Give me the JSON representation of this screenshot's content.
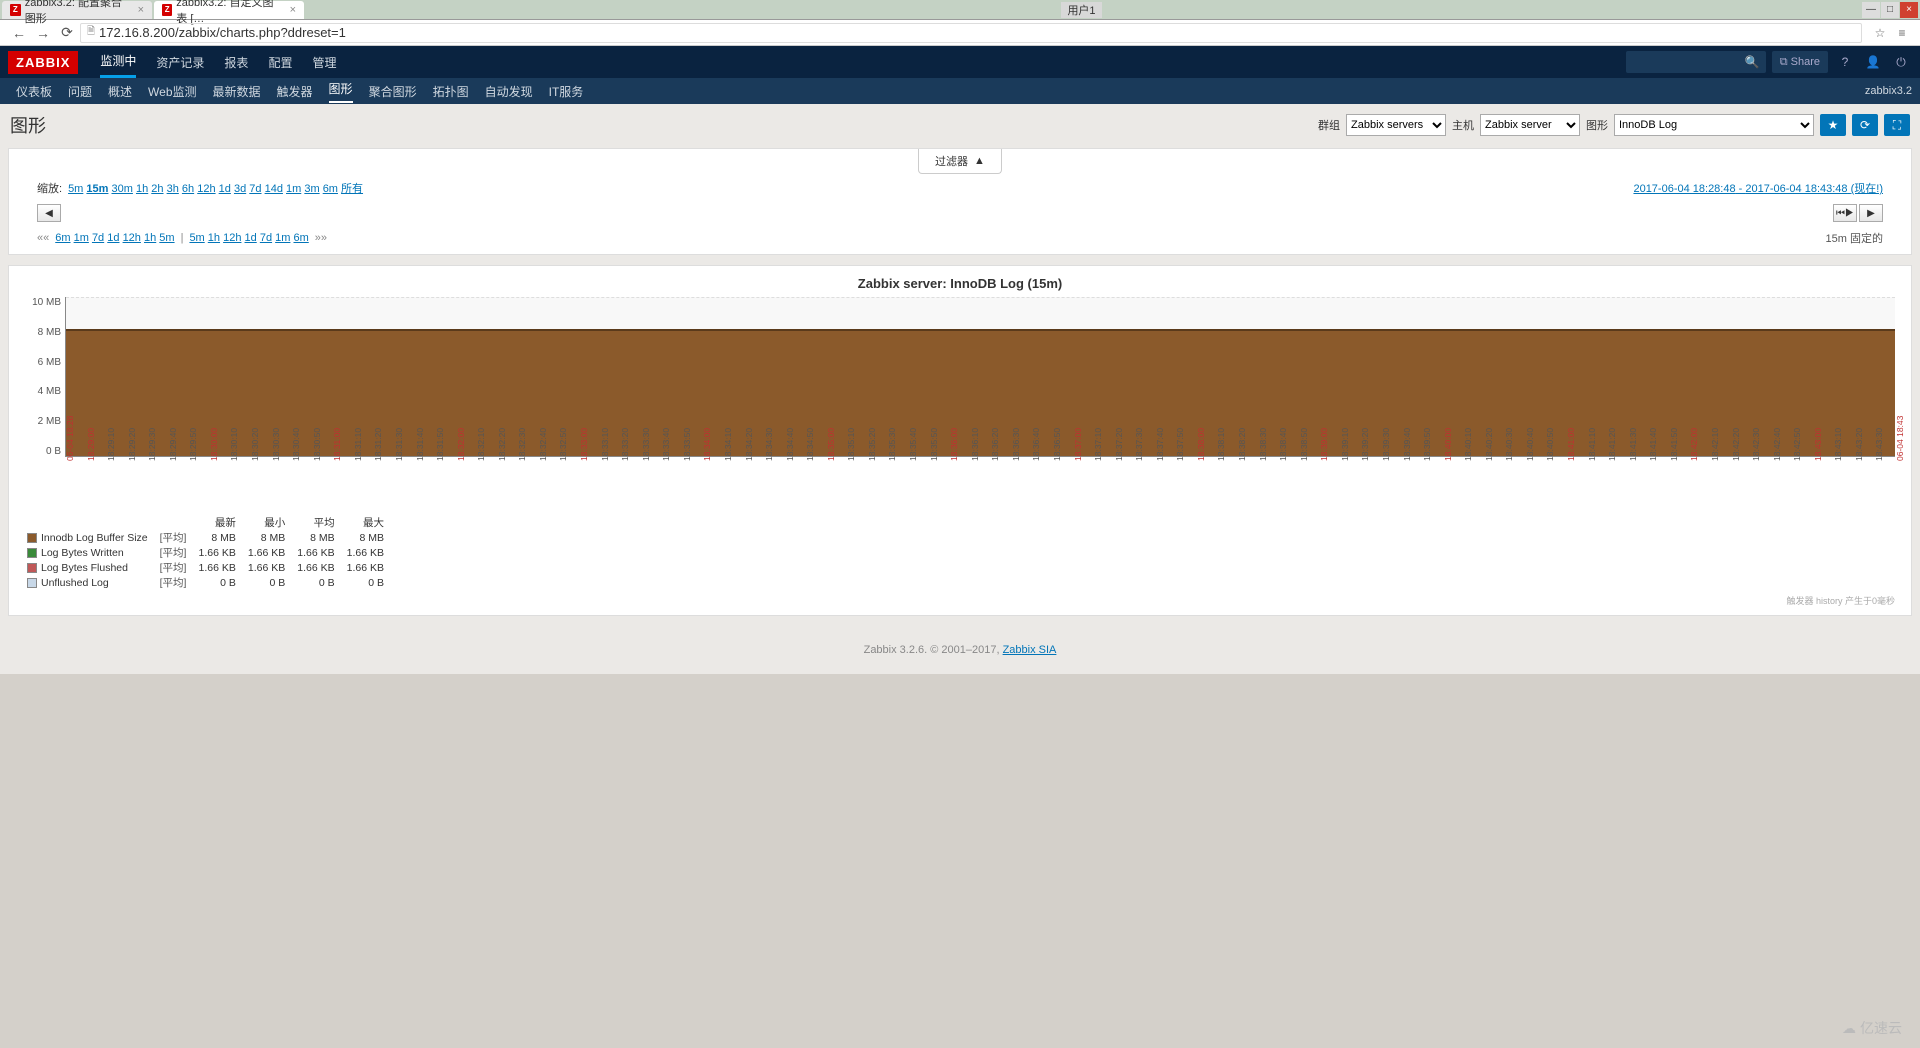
{
  "browser": {
    "tabs": [
      {
        "title": "zabbix3.2: 配置聚合图形"
      },
      {
        "title": "zabbix3.2: 自定义图表 […"
      }
    ],
    "user_badge": "用户1",
    "url": "172.16.8.200/zabbix/charts.php?ddreset=1"
  },
  "top_nav": {
    "logo": "ZABBIX",
    "items": [
      "监测中",
      "资产记录",
      "报表",
      "配置",
      "管理"
    ],
    "active_index": 0,
    "share": "Share"
  },
  "sub_nav": {
    "items": [
      "仪表板",
      "问题",
      "概述",
      "Web监测",
      "最新数据",
      "触发器",
      "图形",
      "聚合图形",
      "拓扑图",
      "自动发现",
      "IT服务"
    ],
    "active_index": 6,
    "right": "zabbix3.2"
  },
  "page_head": {
    "title": "图形",
    "group_label": "群组",
    "group_value": "Zabbix servers",
    "host_label": "主机",
    "host_value": "Zabbix server",
    "graph_label": "图形",
    "graph_value": "InnoDB Log"
  },
  "filter": {
    "tab": "过滤器",
    "zoom_label": "缩放:",
    "zoom_opts": [
      "5m",
      "15m",
      "30m",
      "1h",
      "2h",
      "3h",
      "6h",
      "12h",
      "1d",
      "3d",
      "7d",
      "14d",
      "1m",
      "3m",
      "6m",
      "所有"
    ],
    "zoom_active": "15m",
    "time_from": "2017-06-04 18:28:48",
    "time_to": "2017-06-04 18:43:48",
    "now_suffix": "(现在!)",
    "shift_left": [
      "6m",
      "1m",
      "7d",
      "1d",
      "12h",
      "1h",
      "5m"
    ],
    "shift_right": [
      "5m",
      "1h",
      "12h",
      "1d",
      "7d",
      "1m",
      "6m"
    ],
    "fixed_label": "固定的",
    "fixed_value": "15m"
  },
  "chart_data": {
    "type": "area",
    "title": "Zabbix server: InnoDB Log (15m)",
    "ylabel": "",
    "ylim": [
      0,
      10485760
    ],
    "y_ticks": [
      "10 MB",
      "8 MB",
      "6 MB",
      "4 MB",
      "2 MB",
      "0 B"
    ],
    "x_range": [
      "06-04 18:28",
      "06-04 18:43"
    ],
    "x_ticks": [
      {
        "t": "06-04 18:28",
        "red": true
      },
      {
        "t": "18:29:00",
        "red": true
      },
      {
        "t": "18:29:10"
      },
      {
        "t": "18:29:20"
      },
      {
        "t": "18:29:30"
      },
      {
        "t": "18:29:40"
      },
      {
        "t": "18:29:50"
      },
      {
        "t": "18:30:00",
        "red": true
      },
      {
        "t": "18:30:10"
      },
      {
        "t": "18:30:20"
      },
      {
        "t": "18:30:30"
      },
      {
        "t": "18:30:40"
      },
      {
        "t": "18:30:50"
      },
      {
        "t": "18:31:00",
        "red": true
      },
      {
        "t": "18:31:10"
      },
      {
        "t": "18:31:20"
      },
      {
        "t": "18:31:30"
      },
      {
        "t": "18:31:40"
      },
      {
        "t": "18:31:50"
      },
      {
        "t": "18:32:00",
        "red": true
      },
      {
        "t": "18:32:10"
      },
      {
        "t": "18:32:20"
      },
      {
        "t": "18:32:30"
      },
      {
        "t": "18:32:40"
      },
      {
        "t": "18:32:50"
      },
      {
        "t": "18:33:00",
        "red": true
      },
      {
        "t": "18:33:10"
      },
      {
        "t": "18:33:20"
      },
      {
        "t": "18:33:30"
      },
      {
        "t": "18:33:40"
      },
      {
        "t": "18:33:50"
      },
      {
        "t": "18:34:00",
        "red": true
      },
      {
        "t": "18:34:10"
      },
      {
        "t": "18:34:20"
      },
      {
        "t": "18:34:30"
      },
      {
        "t": "18:34:40"
      },
      {
        "t": "18:34:50"
      },
      {
        "t": "18:35:00",
        "red": true
      },
      {
        "t": "18:35:10"
      },
      {
        "t": "18:35:20"
      },
      {
        "t": "18:35:30"
      },
      {
        "t": "18:35:40"
      },
      {
        "t": "18:35:50"
      },
      {
        "t": "18:36:00",
        "red": true
      },
      {
        "t": "18:36:10"
      },
      {
        "t": "18:36:20"
      },
      {
        "t": "18:36:30"
      },
      {
        "t": "18:36:40"
      },
      {
        "t": "18:36:50"
      },
      {
        "t": "18:37:00",
        "red": true
      },
      {
        "t": "18:37:10"
      },
      {
        "t": "18:37:20"
      },
      {
        "t": "18:37:30"
      },
      {
        "t": "18:37:40"
      },
      {
        "t": "18:37:50"
      },
      {
        "t": "18:38:00",
        "red": true
      },
      {
        "t": "18:38:10"
      },
      {
        "t": "18:38:20"
      },
      {
        "t": "18:38:30"
      },
      {
        "t": "18:38:40"
      },
      {
        "t": "18:38:50"
      },
      {
        "t": "18:39:00",
        "red": true
      },
      {
        "t": "18:39:10"
      },
      {
        "t": "18:39:20"
      },
      {
        "t": "18:39:30"
      },
      {
        "t": "18:39:40"
      },
      {
        "t": "18:39:50"
      },
      {
        "t": "18:40:00",
        "red": true
      },
      {
        "t": "18:40:10"
      },
      {
        "t": "18:40:20"
      },
      {
        "t": "18:40:30"
      },
      {
        "t": "18:40:40"
      },
      {
        "t": "18:40:50"
      },
      {
        "t": "18:41:00",
        "red": true
      },
      {
        "t": "18:41:10"
      },
      {
        "t": "18:41:20"
      },
      {
        "t": "18:41:30"
      },
      {
        "t": "18:41:40"
      },
      {
        "t": "18:41:50"
      },
      {
        "t": "18:42:00",
        "red": true
      },
      {
        "t": "18:42:10"
      },
      {
        "t": "18:42:20"
      },
      {
        "t": "18:42:30"
      },
      {
        "t": "18:42:40"
      },
      {
        "t": "18:42:50"
      },
      {
        "t": "18:43:00",
        "red": true
      },
      {
        "t": "18:43:10"
      },
      {
        "t": "18:43:20"
      },
      {
        "t": "18:43:30"
      },
      {
        "t": "06-04 18:43",
        "red": true
      }
    ],
    "series": [
      {
        "name": "Innodb Log Buffer Size",
        "color": "#8b5a2b",
        "agg": "[平均]",
        "last": "8 MB",
        "min": "8 MB",
        "avg": "8 MB",
        "max": "8 MB",
        "value_bytes": 8388608
      },
      {
        "name": "Log Bytes Written",
        "color": "#3a8a3a",
        "agg": "[平均]",
        "last": "1.66 KB",
        "min": "1.66 KB",
        "avg": "1.66 KB",
        "max": "1.66 KB",
        "value_bytes": 1699
      },
      {
        "name": "Log Bytes Flushed",
        "color": "#c05858",
        "agg": "[平均]",
        "last": "1.66 KB",
        "min": "1.66 KB",
        "avg": "1.66 KB",
        "max": "1.66 KB",
        "value_bytes": 1699
      },
      {
        "name": "Unflushed Log",
        "color": "#c8d8e8",
        "agg": "[平均]",
        "last": "0 B",
        "min": "0 B",
        "avg": "0 B",
        "max": "0 B",
        "value_bytes": 0
      }
    ],
    "legend_headers": [
      "最新",
      "最小",
      "平均",
      "最大"
    ],
    "legend_footer": "触发器 history 产生于0毫秒"
  },
  "footer": {
    "text": "Zabbix 3.2.6. © 2001–2017, ",
    "link": "Zabbix SIA"
  },
  "watermark": "亿速云"
}
